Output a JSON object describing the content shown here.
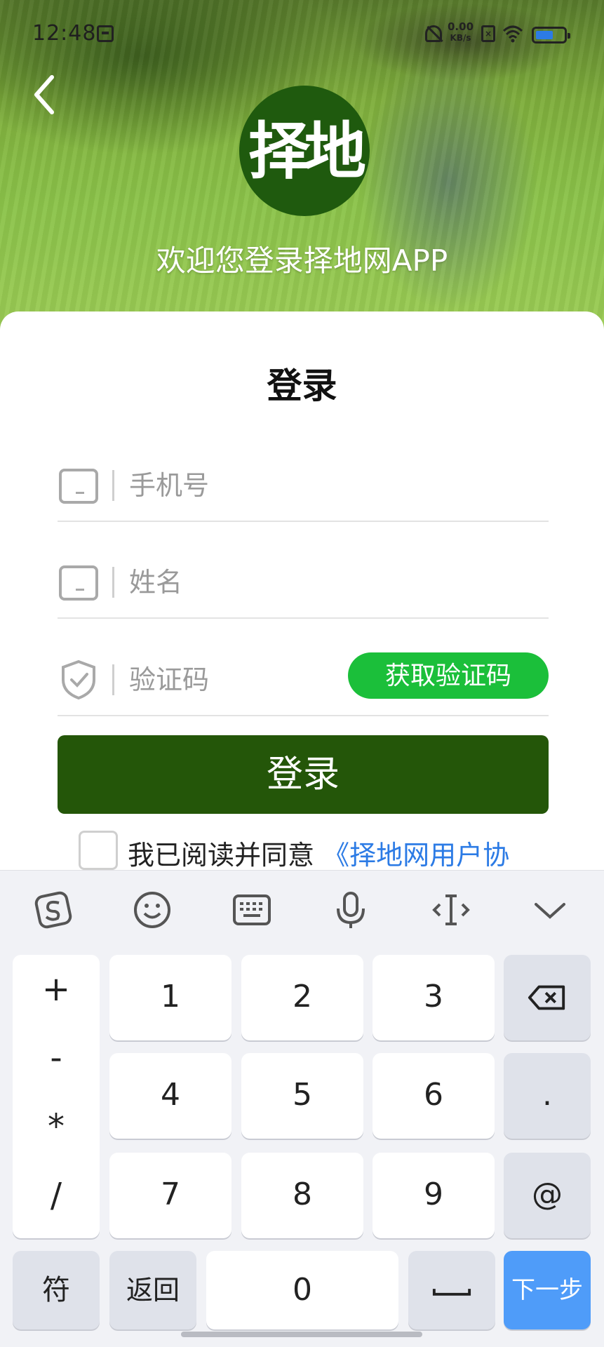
{
  "status_bar": {
    "time": "12:48",
    "net_speed_value": "0.00",
    "net_speed_unit": "KB/s"
  },
  "header": {
    "logo_text": "择地",
    "welcome": "欢迎您登录择地网APP"
  },
  "login_card": {
    "title": "登录",
    "phone_placeholder": "手机号",
    "name_placeholder": "姓名",
    "code_placeholder": "验证码",
    "get_code_label": "获取验证码",
    "login_label": "登录",
    "agree_text": "我已阅读并同意",
    "agree_link": "《择地网用户协"
  },
  "keyboard": {
    "toolbar_icons": [
      "sogou-icon",
      "emoji-icon",
      "keyboard-icon",
      "microphone-icon",
      "cursor-icon",
      "collapse-icon"
    ],
    "ops": [
      "+",
      "-",
      "*",
      "/"
    ],
    "digits": [
      "1",
      "2",
      "3",
      "4",
      "5",
      "6",
      "7",
      "8",
      "9",
      "0"
    ],
    "dot": ".",
    "at": "@",
    "symbols_label": "符",
    "back_label": "返回",
    "next_label": "下一步"
  },
  "colors": {
    "brand_green": "#245609",
    "code_button_green": "#1bbf3a",
    "link_blue": "#2c7be5",
    "next_key_blue": "#4f9cf9"
  }
}
